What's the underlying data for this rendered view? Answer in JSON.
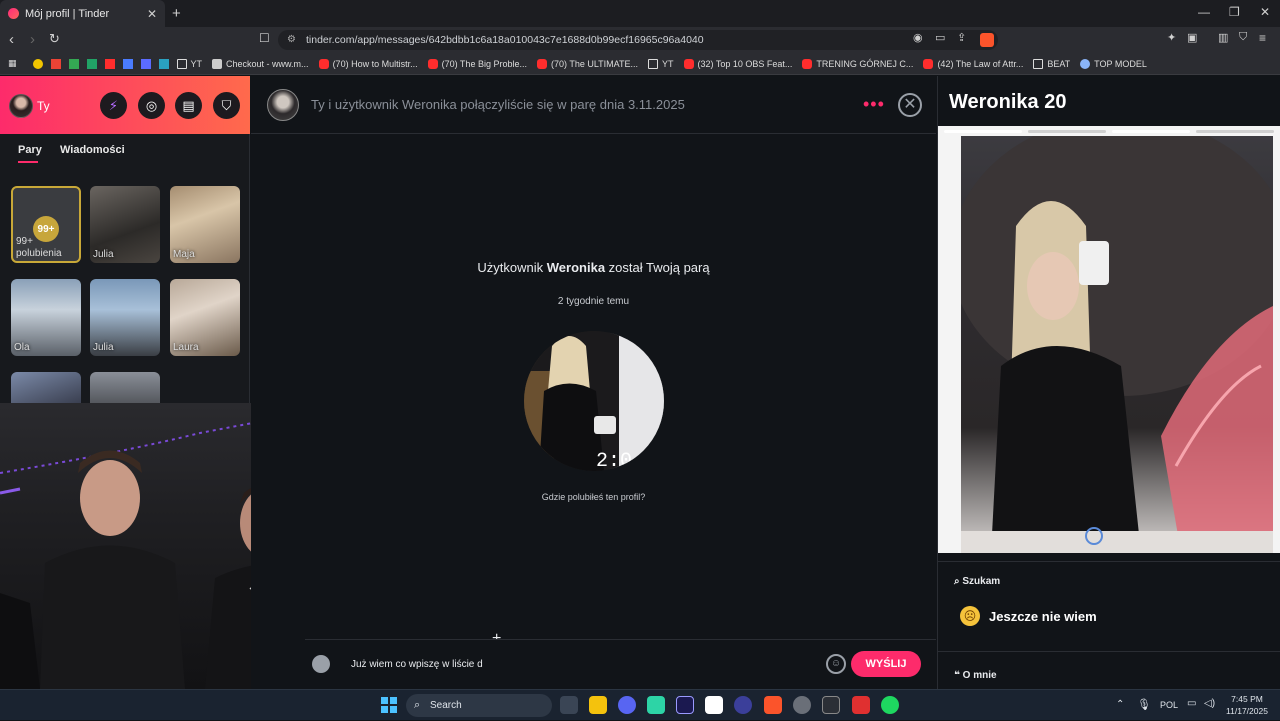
{
  "browser": {
    "tab_title": "Mój profil | Tinder",
    "url": "tinder.com/app/messages/642bdbb1c6a18a010043c7e1688d0b99ecf16965c96a4040",
    "bookmarks": [
      {
        "label": "YT",
        "kind": "folder"
      },
      {
        "label": "Checkout - www.m...",
        "kind": "page"
      },
      {
        "label": "(70) How to Multistr...",
        "kind": "yt"
      },
      {
        "label": "(70) The Big Proble...",
        "kind": "yt"
      },
      {
        "label": "(70) The ULTIMATE...",
        "kind": "yt"
      },
      {
        "label": "YT",
        "kind": "folder"
      },
      {
        "label": "(32) Top 10 OBS Feat...",
        "kind": "yt"
      },
      {
        "label": "TRENING GÓRNEJ C...",
        "kind": "yt"
      },
      {
        "label": "(42) The Law of Attr...",
        "kind": "yt"
      },
      {
        "label": "BEAT",
        "kind": "folder"
      },
      {
        "label": "TOP MODEL",
        "kind": "page"
      }
    ]
  },
  "sidebar": {
    "user_label": "Ty",
    "tabs": [
      "Pary",
      "Wiadomości"
    ],
    "likes_count": "99+",
    "likes_count_text": "99+",
    "likes_label": "polubienia",
    "matches": [
      "Julia",
      "Maja",
      "Ola",
      "Julia",
      "Laura"
    ]
  },
  "chat": {
    "header_text": "Ty i użytkownik Weronika połączyliście się w parę dnia 3.11.2025",
    "match_prefix": "Użytkownik ",
    "match_name": "Weronika",
    "match_suffix": " został Twoją parą",
    "match_time": "2 tygodnie temu",
    "question": "Gdzie polubiłeś ten profil?",
    "message_draft": "Już wiem co wpiszę w liście d",
    "send_label": "WYŚLIJ"
  },
  "profile": {
    "name_age": "Weronika 20",
    "looking_for_label": "Szukam",
    "looking_for_value": "Jeszcze nie wiem",
    "about_label": "O mnie",
    "photo_count": 4
  },
  "taskbar": {
    "search_label": "Search",
    "language": "POL",
    "time": "7:45 PM",
    "date": "11/17/2025"
  },
  "colors": {
    "accent": "#fd2b6b",
    "gold": "#c8a838",
    "background": "#111418"
  }
}
